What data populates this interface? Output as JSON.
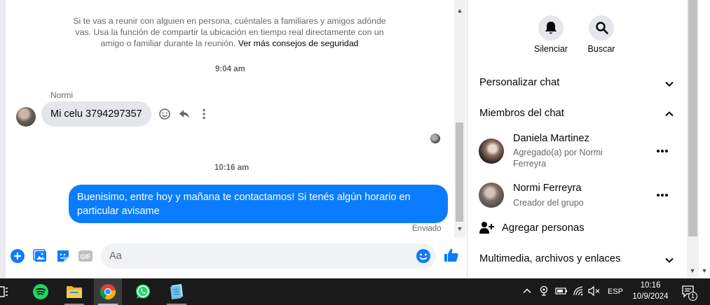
{
  "chat": {
    "safety_text": "Si te vas a reunir con alguien en persona, cuéntales a familiares y amigos adónde vas. Usa la función de compartir la ubicación en tiempo real directamente con un amigo o familiar durante la reunión.",
    "safety_link": "Ver más consejos de seguridad",
    "timestamp_1": "9:04 am",
    "incoming_sender": "Normi",
    "incoming_text": "Mi celu 3794297357",
    "timestamp_2": "10:16 am",
    "outgoing_text": "Buenisimo, entre hoy y mañana te contactamos! Si tenés algún horario en particular avisame",
    "sent_status": "Enviado",
    "composer_placeholder": "Aa"
  },
  "panel": {
    "mute_label": "Silenciar",
    "search_label": "Buscar",
    "customize_label": "Personalizar chat",
    "members_label": "Miembros del chat",
    "members": [
      {
        "name": "Daniela Martinez",
        "sub": "Agregado(a) por Normi Ferreyra"
      },
      {
        "name": "Normi Ferreyra",
        "sub": "Creador del grupo"
      }
    ],
    "add_people_label": "Agregar personas",
    "media_label": "Multimedia, archivos y enlaces"
  },
  "taskbar": {
    "language": "ESP",
    "time": "10:16",
    "date": "10/9/2024",
    "notification_count": "1"
  },
  "colors": {
    "messenger_blue": "#0a7cff",
    "bubble_gray": "#e4e6eb",
    "taskbar": "#1a1a1a"
  },
  "icons": [
    "add-icon",
    "photo-icon",
    "sticker-icon",
    "gif-icon",
    "emoji-icon",
    "like-icon",
    "bell-icon",
    "search-icon",
    "chevron-down-icon",
    "chevron-up-icon",
    "more-icon",
    "add-person-icon",
    "spotify-icon",
    "folder-icon",
    "chrome-icon",
    "whatsapp-icon",
    "notepad-icon"
  ]
}
